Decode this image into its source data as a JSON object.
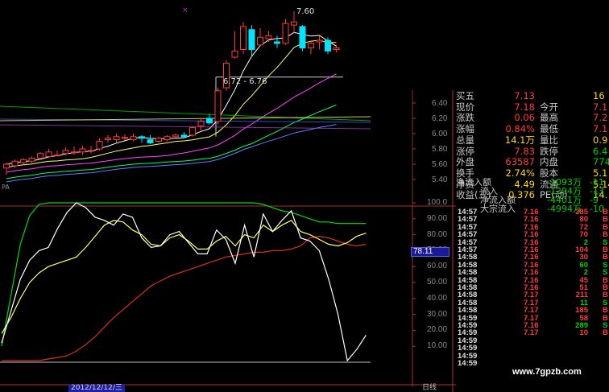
{
  "colors": {
    "background": "#000000",
    "price_up": "#ff3b3b",
    "price_down": "#00e5ff",
    "green_text": "#00d000",
    "yellow_text": "#ffd700",
    "label_text": "#c8c8c8",
    "kdj_k": "#ffffff",
    "kdj_d": "#ffff66",
    "kdj_j": "#00dd00",
    "red_line": "#d83020",
    "axis_box": "#3030a0"
  },
  "header": {
    "highlight_marker": "×"
  },
  "candle_chart": {
    "peak_label": "7.60",
    "range_box_label": "6.72 - 6.76",
    "y_ticks": [
      "6.40",
      "6.20",
      "6.00",
      "5.80",
      "5.60",
      "5.40"
    ],
    "corner_label": "PA",
    "candles": [
      {
        "o": 5.55,
        "h": 5.62,
        "l": 5.46,
        "c": 5.6
      },
      {
        "o": 5.58,
        "h": 5.66,
        "l": 5.55,
        "c": 5.64
      },
      {
        "o": 5.62,
        "h": 5.68,
        "l": 5.6,
        "c": 5.66
      },
      {
        "o": 5.64,
        "h": 5.7,
        "l": 5.62,
        "c": 5.68
      },
      {
        "o": 5.68,
        "h": 5.76,
        "l": 5.66,
        "c": 5.74
      },
      {
        "o": 5.7,
        "h": 5.8,
        "l": 5.68,
        "c": 5.76
      },
      {
        "o": 5.72,
        "h": 5.78,
        "l": 5.7,
        "c": 5.72
      },
      {
        "o": 5.74,
        "h": 5.82,
        "l": 5.72,
        "c": 5.78
      },
      {
        "o": 5.76,
        "h": 5.83,
        "l": 5.72,
        "c": 5.76
      },
      {
        "o": 5.76,
        "h": 5.84,
        "l": 5.72,
        "c": 5.8
      },
      {
        "o": 5.78,
        "h": 5.84,
        "l": 5.74,
        "c": 5.78
      },
      {
        "o": 5.8,
        "h": 5.94,
        "l": 5.78,
        "c": 5.9
      },
      {
        "o": 5.92,
        "h": 5.98,
        "l": 5.88,
        "c": 5.94
      },
      {
        "o": 5.92,
        "h": 6.0,
        "l": 5.88,
        "c": 5.96
      },
      {
        "o": 5.95,
        "h": 5.99,
        "l": 5.91,
        "c": 5.95
      },
      {
        "o": 5.92,
        "h": 6.0,
        "l": 5.9,
        "c": 5.96
      },
      {
        "o": 5.96,
        "h": 5.98,
        "l": 5.88,
        "c": 5.94
      },
      {
        "o": 5.92,
        "h": 5.98,
        "l": 5.86,
        "c": 5.88
      },
      {
        "o": 5.9,
        "h": 5.96,
        "l": 5.88,
        "c": 5.94
      },
      {
        "o": 5.92,
        "h": 5.98,
        "l": 5.9,
        "c": 5.96
      },
      {
        "o": 5.96,
        "h": 6.0,
        "l": 5.94,
        "c": 5.98
      },
      {
        "o": 5.98,
        "h": 6.02,
        "l": 5.94,
        "c": 5.96
      },
      {
        "o": 5.98,
        "h": 6.1,
        "l": 5.96,
        "c": 6.08
      },
      {
        "o": 6.1,
        "h": 6.2,
        "l": 6.04,
        "c": 6.16
      },
      {
        "o": 6.2,
        "h": 6.26,
        "l": 6.12,
        "c": 6.14
      },
      {
        "o": 6.16,
        "h": 6.6,
        "l": 6.12,
        "c": 6.56
      },
      {
        "o": 6.6,
        "h": 6.96,
        "l": 6.56,
        "c": 6.92
      },
      {
        "o": 7.0,
        "h": 7.34,
        "l": 6.98,
        "c": 7.08
      },
      {
        "o": 7.1,
        "h": 7.46,
        "l": 7.04,
        "c": 7.4
      },
      {
        "o": 7.36,
        "h": 7.42,
        "l": 7.02,
        "c": 7.1
      },
      {
        "o": 7.16,
        "h": 7.38,
        "l": 7.14,
        "c": 7.26
      },
      {
        "o": 7.24,
        "h": 7.34,
        "l": 7.2,
        "c": 7.28
      },
      {
        "o": 7.2,
        "h": 7.28,
        "l": 7.12,
        "c": 7.18
      },
      {
        "o": 7.18,
        "h": 7.5,
        "l": 7.16,
        "c": 7.44
      },
      {
        "o": 7.42,
        "h": 7.6,
        "l": 7.32,
        "c": 7.46
      },
      {
        "o": 7.4,
        "h": 7.42,
        "l": 7.08,
        "c": 7.12
      },
      {
        "o": 7.12,
        "h": 7.22,
        "l": 7.04,
        "c": 7.18
      },
      {
        "o": 7.2,
        "h": 7.28,
        "l": 7.1,
        "c": 7.22
      },
      {
        "o": 7.22,
        "h": 7.26,
        "l": 7.04,
        "c": 7.08
      },
      {
        "o": 7.1,
        "h": 7.16,
        "l": 7.06,
        "c": 7.12
      }
    ]
  },
  "quote_panel": {
    "top_partial": "买五",
    "rows": [
      {
        "l1": "买五",
        "v1": "7.13",
        "l2": "",
        "v2": "16",
        "c1": "red",
        "c2": "yellow"
      },
      {
        "l1": "现价",
        "v1": "7.18",
        "l2": "今开",
        "v2": "7.1",
        "c1": "red",
        "c2": "red"
      },
      {
        "l1": "涨跌",
        "v1": "0.06",
        "l2": "最高",
        "v2": "7.2",
        "c1": "red",
        "c2": "red"
      },
      {
        "l1": "涨幅",
        "v1": "0.84%",
        "l2": "最低",
        "v2": "7.1",
        "c1": "red",
        "c2": "red"
      },
      {
        "l1": "总量",
        "v1": "14.1万",
        "l2": "量比",
        "v2": "0.9",
        "c1": "yellow",
        "c2": "yellow"
      },
      {
        "l1": "涨停",
        "v1": "7.83",
        "l2": "跌停",
        "v2": "6.4",
        "c1": "red",
        "c2": "green"
      },
      {
        "l1": "外盘",
        "v1": "63587",
        "l2": "内盘",
        "v2": "7742",
        "c1": "red",
        "c2": "green"
      },
      {
        "l1": "换手",
        "v1": "2.74%",
        "l2": "股本",
        "v2": "5.1",
        "c1": "yellow",
        "c2": "yellow"
      },
      {
        "l1": "净资",
        "v1": "4.49",
        "l2": "流通",
        "v2": "5.14",
        "c1": "yellow",
        "c2": "yellow"
      },
      {
        "l1": "收益(三)",
        "v1": "0.376",
        "l2": "PE(动)",
        "v2": "14.",
        "c1": "yellow",
        "c2": "yellow"
      }
    ],
    "flow": [
      {
        "label": "净流入额",
        "v1": "-1093万",
        "v2": "-11"
      },
      {
        "label": "流入",
        "v1": "-1294万",
        "v2": "-13"
      },
      {
        "label": "净流入额",
        "v1": "-4401万",
        "v2": "-9"
      },
      {
        "label": "大宗流入",
        "v1": "-4994万",
        "v2": "-10"
      }
    ]
  },
  "tick_list": [
    {
      "t": "14:57",
      "p": "7.16",
      "v": "285",
      "f": "B",
      "pc": "red",
      "fc": "red"
    },
    {
      "t": "14:57",
      "p": "7.16",
      "v": "80",
      "f": "B",
      "pc": "red",
      "fc": "red"
    },
    {
      "t": "14:57",
      "p": "7.16",
      "v": "72",
      "f": "B",
      "pc": "red",
      "fc": "red"
    },
    {
      "t": "14:57",
      "p": "7.16",
      "v": "70",
      "f": "B",
      "pc": "red",
      "fc": "red"
    },
    {
      "t": "14:57",
      "p": "7.16",
      "v": "2",
      "f": "S",
      "pc": "red",
      "fc": "green"
    },
    {
      "t": "14:57",
      "p": "7.16",
      "v": "104",
      "f": "B",
      "pc": "red",
      "fc": "red"
    },
    {
      "t": "14:58",
      "p": "7.16",
      "v": "30",
      "f": "B",
      "pc": "red",
      "fc": "red"
    },
    {
      "t": "14:58",
      "p": "7.16",
      "v": "60",
      "f": "S",
      "pc": "red",
      "fc": "green"
    },
    {
      "t": "14:58",
      "p": "7.16",
      "v": "2",
      "f": "S",
      "pc": "red",
      "fc": "green"
    },
    {
      "t": "14:58",
      "p": "7.16",
      "v": "45",
      "f": "B",
      "pc": "red",
      "fc": "red"
    },
    {
      "t": "14:58",
      "p": "7.16",
      "v": "51",
      "f": "B",
      "pc": "red",
      "fc": "red"
    },
    {
      "t": "14:58",
      "p": "7.17",
      "v": "211",
      "f": "B",
      "pc": "red",
      "fc": "red"
    },
    {
      "t": "14:58",
      "p": "7.17",
      "v": "11",
      "f": "S",
      "pc": "red",
      "fc": "green"
    },
    {
      "t": "14:58",
      "p": "7.17",
      "v": "185",
      "f": "B",
      "pc": "red",
      "fc": "red"
    },
    {
      "t": "14:59",
      "p": "7.17",
      "v": "58",
      "f": "B",
      "pc": "red",
      "fc": "red"
    },
    {
      "t": "14:59",
      "p": "7.16",
      "v": "289",
      "f": "S",
      "pc": "red",
      "fc": "green"
    },
    {
      "t": "14:59",
      "p": "7.17",
      "v": "10",
      "f": "B",
      "pc": "red",
      "fc": "red"
    },
    {
      "t": "14:59",
      "p": "",
      "v": "",
      "f": "",
      "pc": "red",
      "fc": "red"
    },
    {
      "t": "14:59",
      "p": "",
      "v": "",
      "f": "",
      "pc": "red",
      "fc": "red"
    },
    {
      "t": "14:59",
      "p": "",
      "v": "",
      "f": "",
      "pc": "red",
      "fc": "red"
    },
    {
      "t": "14:59",
      "p": "",
      "v": "",
      "f": "",
      "pc": "red",
      "fc": "red"
    }
  ],
  "indicator": {
    "y_ticks": [
      "100.0",
      "90.00",
      "80.00",
      "70.00",
      "60.00",
      "50.00",
      "40.00",
      "30.00",
      "20.00",
      "10.00"
    ],
    "current_value": "78.11",
    "white": [
      12,
      32,
      52,
      64,
      70,
      72,
      84,
      94,
      100,
      97,
      91,
      89,
      86,
      93,
      91,
      78,
      72,
      73,
      80,
      82,
      75,
      68,
      68,
      83,
      77,
      62,
      86,
      66,
      93,
      82,
      89,
      95,
      78,
      76,
      70,
      52,
      30,
      1,
      8,
      17
    ],
    "yellow": [
      18,
      28,
      40,
      50,
      56,
      60,
      62,
      64,
      66,
      72,
      79,
      86,
      89,
      88,
      83,
      80,
      74,
      73,
      78,
      80,
      76,
      71,
      71,
      76,
      79,
      73,
      80,
      78,
      86,
      82,
      86,
      89,
      82,
      80,
      77,
      74,
      73,
      75,
      79,
      81
    ],
    "green": [
      10,
      42,
      74,
      92,
      99,
      100,
      100,
      100,
      100,
      100,
      100,
      100,
      100,
      100,
      100,
      100,
      100,
      100,
      100,
      100,
      100,
      100,
      100,
      100,
      100,
      100,
      100,
      100,
      99,
      97,
      95,
      94,
      92,
      90,
      88,
      88,
      87,
      87,
      87,
      87
    ],
    "red": [
      1,
      1,
      1,
      1,
      1,
      2,
      3,
      4,
      7,
      11,
      16,
      22,
      28,
      33,
      38,
      43,
      48,
      51,
      54,
      56,
      58,
      60,
      62,
      64,
      66,
      67,
      68,
      69,
      69,
      70,
      70,
      71,
      73,
      78,
      79,
      78,
      76,
      74,
      73,
      74
    ]
  },
  "bottom_bar": {
    "date_label": "2012/12/12/三",
    "period_label": "日线",
    "watermark": "www.7gpzb.com"
  }
}
